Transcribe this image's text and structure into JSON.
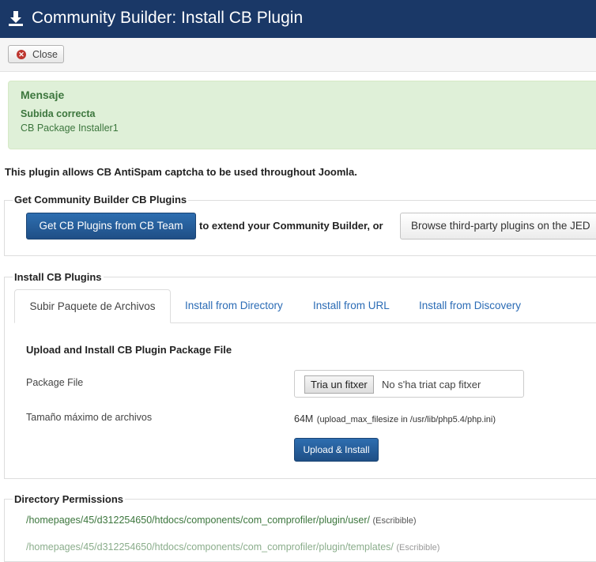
{
  "header": {
    "title": "Community Builder: Install CB Plugin",
    "icon": "download-icon"
  },
  "toolbar": {
    "close_label": "Close",
    "close_icon": "close-circle-icon"
  },
  "alert": {
    "heading": "Mensaje",
    "line1": "Subida correcta",
    "line2": "CB Package Installer1"
  },
  "description": "This plugin allows CB AntiSpam captcha to be used throughout Joomla.",
  "get_plugins": {
    "legend": "Get Community Builder CB Plugins",
    "primary_button": "Get CB Plugins from CB Team",
    "middle_text": "to extend your Community Builder, or",
    "secondary_button": "Browse third-party plugins on the JED"
  },
  "install": {
    "legend": "Install CB Plugins",
    "tabs": [
      {
        "label": "Subir Paquete de Archivos",
        "active": true
      },
      {
        "label": "Install from Directory",
        "active": false
      },
      {
        "label": "Install from URL",
        "active": false
      },
      {
        "label": "Install from Discovery",
        "active": false
      }
    ],
    "subheading": "Upload and Install CB Plugin Package File",
    "package_label": "Package File",
    "file_button": "Tria un fitxer",
    "file_status": "No s'ha triat cap fitxer",
    "max_label": "Tamaño máximo de archivos",
    "max_value": "64M",
    "max_detail": "(upload_max_filesize in /usr/lib/php5.4/php.ini)",
    "submit": "Upload & Install"
  },
  "permissions": {
    "legend": "Directory Permissions",
    "paths": [
      {
        "path": "/homepages/45/d312254650/htdocs/components/com_comprofiler/plugin/user/",
        "status": "(Escribible)"
      },
      {
        "path": "/homepages/45/d312254650/htdocs/components/com_comprofiler/plugin/templates/",
        "status": "(Escribible)"
      }
    ]
  },
  "colors": {
    "header_bg": "#1a3867",
    "primary": "#2a65a8",
    "success_bg": "#dff0d8",
    "success_text": "#3c763d",
    "link": "#2a6bb5"
  }
}
